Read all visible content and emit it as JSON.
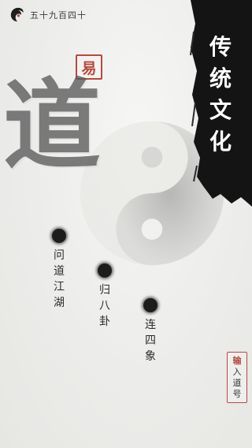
{
  "header": {
    "counter_text": "五十九百四十"
  },
  "seal": {
    "char": "易"
  },
  "watermark": {
    "char": "道"
  },
  "banner": {
    "title_chars": [
      "传",
      "统",
      "文",
      "化"
    ]
  },
  "menu": [
    {
      "chars": [
        "问",
        "道",
        "江",
        "湖"
      ]
    },
    {
      "chars": [
        "归",
        "八",
        "卦"
      ]
    },
    {
      "chars": [
        "连",
        "四",
        "象"
      ]
    }
  ],
  "input_button": {
    "chars": [
      "输",
      "入",
      "道",
      "号"
    ]
  },
  "colors": {
    "accent_red": "#b44a3e",
    "ink": "#1d1d1d",
    "paper": "#efefed"
  },
  "icons": {
    "logo": "brush-swirl-icon",
    "menu_marker": "ink-dot-icon",
    "background": "taiji-icon"
  }
}
